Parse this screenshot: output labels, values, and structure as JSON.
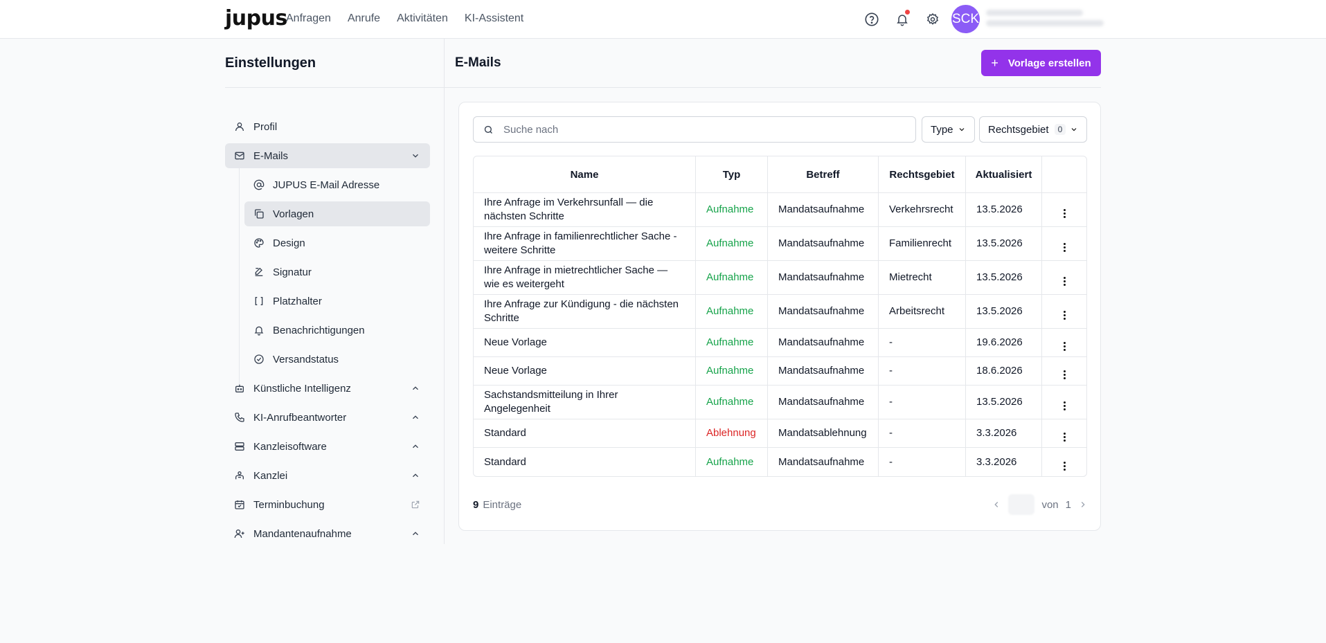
{
  "header": {
    "logo": "jupus",
    "nav": [
      "Anfragen",
      "Anrufe",
      "Aktivitäten",
      "KI-Assistent"
    ],
    "avatar_initials": "SCK"
  },
  "sidebar": {
    "title": "Einstellungen",
    "items": [
      {
        "label": "Profil",
        "icon": "user-icon"
      },
      {
        "label": "E-Mails",
        "icon": "mail-icon",
        "expanded": true
      },
      {
        "label": "Künstliche Intelligenz",
        "icon": "bot-icon"
      },
      {
        "label": "KI-Anrufbeantworter",
        "icon": "phone-icon"
      },
      {
        "label": "Kanzleisoftware",
        "icon": "server-icon"
      },
      {
        "label": "Kanzlei",
        "icon": "building-icon"
      },
      {
        "label": "Terminbuchung",
        "icon": "calendar-icon",
        "external": true
      },
      {
        "label": "Mandantenaufnahme",
        "icon": "user-plus-icon"
      }
    ],
    "email_sub": [
      {
        "label": "JUPUS E-Mail Adresse",
        "icon": "at-icon"
      },
      {
        "label": "Vorlagen",
        "icon": "copy-icon",
        "active": true
      },
      {
        "label": "Design",
        "icon": "palette-icon"
      },
      {
        "label": "Signatur",
        "icon": "signature-icon"
      },
      {
        "label": "Platzhalter",
        "icon": "brackets-icon"
      },
      {
        "label": "Benachrichtigungen",
        "icon": "bell-icon"
      },
      {
        "label": "Versandstatus",
        "icon": "check-circle-icon"
      }
    ]
  },
  "main": {
    "title": "E-Mails",
    "create_label": "Vorlage erstellen",
    "search_placeholder": "Suche nach",
    "filter_type": "Type",
    "filter_rechtsgebiet": "Rechtsgebiet",
    "filter_rechtsgebiet_count": "0",
    "columns": [
      "Name",
      "Typ",
      "Betreff",
      "Rechtsgebiet",
      "Aktualisiert",
      ""
    ],
    "rows": [
      {
        "name": "Ihre Anfrage im Verkehrsunfall — die nächsten Schritte",
        "typ": "Aufnahme",
        "betreff": "Mandatsaufnahme",
        "rechtsgebiet": "Verkehrsrecht",
        "aktualisiert": "13.5.2026"
      },
      {
        "name": "Ihre Anfrage in familienrechtlicher Sache - weitere Schritte",
        "typ": "Aufnahme",
        "betreff": "Mandatsaufnahme",
        "rechtsgebiet": "Familienrecht",
        "aktualisiert": "13.5.2026"
      },
      {
        "name": "Ihre Anfrage in mietrechtlicher Sache — wie es weitergeht",
        "typ": "Aufnahme",
        "betreff": "Mandatsaufnahme",
        "rechtsgebiet": "Mietrecht",
        "aktualisiert": "13.5.2026"
      },
      {
        "name": "Ihre Anfrage zur Kündigung - die nächsten Schritte",
        "typ": "Aufnahme",
        "betreff": "Mandatsaufnahme",
        "rechtsgebiet": "Arbeitsrecht",
        "aktualisiert": "13.5.2026"
      },
      {
        "name": "Neue Vorlage",
        "typ": "Aufnahme",
        "betreff": "Mandatsaufnahme",
        "rechtsgebiet": "-",
        "aktualisiert": "19.6.2026"
      },
      {
        "name": "Neue Vorlage",
        "typ": "Aufnahme",
        "betreff": "Mandatsaufnahme",
        "rechtsgebiet": "-",
        "aktualisiert": "18.6.2026"
      },
      {
        "name": "Sachstandsmitteilung in Ihrer Angelegenheit",
        "typ": "Aufnahme",
        "betreff": "Mandatsaufnahme",
        "rechtsgebiet": "-",
        "aktualisiert": "13.5.2026"
      },
      {
        "name": "Standard",
        "typ": "Ablehnung",
        "betreff": "Mandatsablehnung",
        "rechtsgebiet": "-",
        "aktualisiert": "3.3.2026"
      },
      {
        "name": "Standard",
        "typ": "Aufnahme",
        "betreff": "Mandatsaufnahme",
        "rechtsgebiet": "-",
        "aktualisiert": "3.3.2026"
      }
    ],
    "count": "9",
    "count_label": "Einträge",
    "page_of": "von",
    "page_total": "1"
  },
  "colors": {
    "accent": "#9333ea",
    "aufnahme": "#16a34a",
    "ablehnung": "#dc2626",
    "avatar": "#8b5cf6"
  }
}
